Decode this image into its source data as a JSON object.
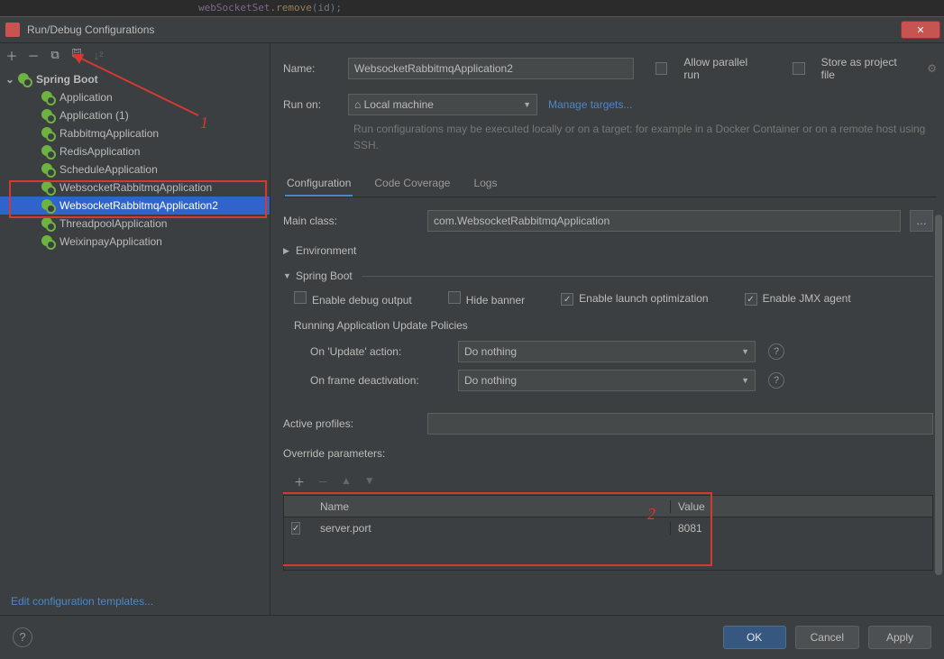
{
  "top_code": {
    "kw": "webSocketSet",
    "fn": ".remove",
    "id": "(id);"
  },
  "window": {
    "title": "Run/Debug Configurations"
  },
  "annotations": {
    "one": "1",
    "two": "2"
  },
  "sidebar": {
    "root": "Spring Boot",
    "items": [
      "Application",
      "Application (1)",
      "RabbitmqApplication",
      "RedisApplication",
      "ScheduleApplication",
      "WebsocketRabbitmqApplication",
      "WebsocketRabbitmqApplication2",
      "ThreadpoolApplication",
      "WeixinpayApplication"
    ],
    "selected_index": 6,
    "edit_templates": "Edit configuration templates..."
  },
  "header": {
    "name_label": "Name:",
    "name_value": "WebsocketRabbitmqApplication2",
    "allow_parallel": "Allow parallel run",
    "store_project": "Store as project file",
    "run_on_label": "Run on:",
    "run_on_value": "Local machine",
    "manage_targets": "Manage targets...",
    "hint": "Run configurations may be executed locally or on a target: for example in a Docker Container or on a remote host using SSH."
  },
  "tabs": {
    "items": [
      "Configuration",
      "Code Coverage",
      "Logs"
    ],
    "active": 0
  },
  "config": {
    "main_class_label": "Main class:",
    "main_class_value": "com.WebsocketRabbitmqApplication",
    "environment": "Environment",
    "spring_boot": "Spring Boot",
    "enable_debug": "Enable debug output",
    "hide_banner": "Hide banner",
    "enable_launch_opt": "Enable launch optimization",
    "enable_jmx": "Enable JMX agent",
    "policies_label": "Running Application Update Policies",
    "on_update_label": "On 'Update' action:",
    "on_update_value": "Do nothing",
    "on_frame_label": "On frame deactivation:",
    "on_frame_value": "Do nothing",
    "active_profiles_label": "Active profiles:",
    "active_profiles_value": "",
    "override_label": "Override parameters:",
    "table": {
      "col_name": "Name",
      "col_value": "Value",
      "rows": [
        {
          "checked": true,
          "name": "server.port",
          "value": "8081"
        }
      ]
    }
  },
  "footer": {
    "ok": "OK",
    "cancel": "Cancel",
    "apply": "Apply"
  },
  "icons": {
    "home": "⌂"
  }
}
